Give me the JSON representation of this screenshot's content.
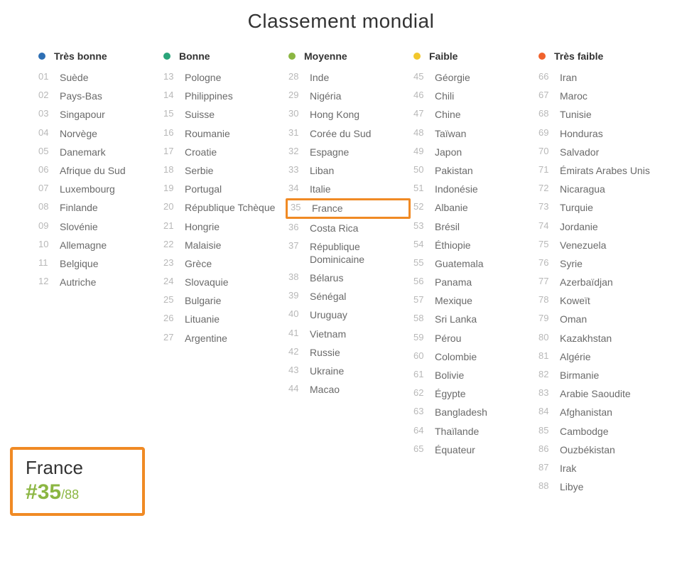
{
  "title": "Classement mondial",
  "categories": [
    {
      "label": "Très bonne",
      "color": "#2e6fb4",
      "items": [
        {
          "rank": "01",
          "name": "Suède"
        },
        {
          "rank": "02",
          "name": "Pays-Bas"
        },
        {
          "rank": "03",
          "name": "Singapour"
        },
        {
          "rank": "04",
          "name": "Norvège"
        },
        {
          "rank": "05",
          "name": "Danemark"
        },
        {
          "rank": "06",
          "name": "Afrique du Sud"
        },
        {
          "rank": "07",
          "name": "Luxembourg"
        },
        {
          "rank": "08",
          "name": "Finlande"
        },
        {
          "rank": "09",
          "name": "Slovénie"
        },
        {
          "rank": "10",
          "name": "Allemagne"
        },
        {
          "rank": "11",
          "name": "Belgique"
        },
        {
          "rank": "12",
          "name": "Autriche"
        }
      ]
    },
    {
      "label": "Bonne",
      "color": "#2aa57a",
      "items": [
        {
          "rank": "13",
          "name": "Pologne"
        },
        {
          "rank": "14",
          "name": "Philippines"
        },
        {
          "rank": "15",
          "name": "Suisse"
        },
        {
          "rank": "16",
          "name": "Roumanie"
        },
        {
          "rank": "17",
          "name": "Croatie"
        },
        {
          "rank": "18",
          "name": "Serbie"
        },
        {
          "rank": "19",
          "name": "Portugal"
        },
        {
          "rank": "20",
          "name": "République Tchèque"
        },
        {
          "rank": "21",
          "name": "Hongrie"
        },
        {
          "rank": "22",
          "name": "Malaisie"
        },
        {
          "rank": "23",
          "name": "Grèce"
        },
        {
          "rank": "24",
          "name": "Slovaquie"
        },
        {
          "rank": "25",
          "name": "Bulgarie"
        },
        {
          "rank": "26",
          "name": "Lituanie"
        },
        {
          "rank": "27",
          "name": "Argentine"
        }
      ]
    },
    {
      "label": "Moyenne",
      "color": "#8bb642",
      "items": [
        {
          "rank": "28",
          "name": "Inde"
        },
        {
          "rank": "29",
          "name": "Nigéria"
        },
        {
          "rank": "30",
          "name": "Hong Kong"
        },
        {
          "rank": "31",
          "name": "Corée du Sud"
        },
        {
          "rank": "32",
          "name": "Espagne"
        },
        {
          "rank": "33",
          "name": "Liban"
        },
        {
          "rank": "34",
          "name": "Italie"
        },
        {
          "rank": "35",
          "name": "France",
          "highlight": true
        },
        {
          "rank": "36",
          "name": "Costa Rica"
        },
        {
          "rank": "37",
          "name": "République Dominicaine"
        },
        {
          "rank": "38",
          "name": "Bélarus"
        },
        {
          "rank": "39",
          "name": "Sénégal"
        },
        {
          "rank": "40",
          "name": "Uruguay"
        },
        {
          "rank": "41",
          "name": "Vietnam"
        },
        {
          "rank": "42",
          "name": "Russie"
        },
        {
          "rank": "43",
          "name": "Ukraine"
        },
        {
          "rank": "44",
          "name": "Macao"
        }
      ]
    },
    {
      "label": "Faible",
      "color": "#f2c72c",
      "items": [
        {
          "rank": "45",
          "name": "Géorgie"
        },
        {
          "rank": "46",
          "name": "Chili"
        },
        {
          "rank": "47",
          "name": "Chine"
        },
        {
          "rank": "48",
          "name": "Taïwan"
        },
        {
          "rank": "49",
          "name": "Japon"
        },
        {
          "rank": "50",
          "name": "Pakistan"
        },
        {
          "rank": "51",
          "name": "Indonésie"
        },
        {
          "rank": "52",
          "name": "Albanie"
        },
        {
          "rank": "53",
          "name": "Brésil"
        },
        {
          "rank": "54",
          "name": "Éthiopie"
        },
        {
          "rank": "55",
          "name": "Guatemala"
        },
        {
          "rank": "56",
          "name": "Panama"
        },
        {
          "rank": "57",
          "name": "Mexique"
        },
        {
          "rank": "58",
          "name": "Sri Lanka"
        },
        {
          "rank": "59",
          "name": "Pérou"
        },
        {
          "rank": "60",
          "name": "Colombie"
        },
        {
          "rank": "61",
          "name": "Bolivie"
        },
        {
          "rank": "62",
          "name": "Égypte"
        },
        {
          "rank": "63",
          "name": "Bangladesh"
        },
        {
          "rank": "64",
          "name": "Thaïlande"
        },
        {
          "rank": "65",
          "name": "Équateur"
        }
      ]
    },
    {
      "label": "Très faible",
      "color": "#f0622c",
      "items": [
        {
          "rank": "66",
          "name": "Iran"
        },
        {
          "rank": "67",
          "name": "Maroc"
        },
        {
          "rank": "68",
          "name": "Tunisie"
        },
        {
          "rank": "69",
          "name": "Honduras"
        },
        {
          "rank": "70",
          "name": "Salvador"
        },
        {
          "rank": "71",
          "name": "Émirats Arabes Unis"
        },
        {
          "rank": "72",
          "name": "Nicaragua"
        },
        {
          "rank": "73",
          "name": "Turquie"
        },
        {
          "rank": "74",
          "name": "Jordanie"
        },
        {
          "rank": "75",
          "name": "Venezuela"
        },
        {
          "rank": "76",
          "name": "Syrie"
        },
        {
          "rank": "77",
          "name": "Azerbaïdjan"
        },
        {
          "rank": "78",
          "name": "Koweït"
        },
        {
          "rank": "79",
          "name": "Oman"
        },
        {
          "rank": "80",
          "name": "Kazakhstan"
        },
        {
          "rank": "81",
          "name": "Algérie"
        },
        {
          "rank": "82",
          "name": "Birmanie"
        },
        {
          "rank": "83",
          "name": "Arabie Saoudite"
        },
        {
          "rank": "84",
          "name": "Afghanistan"
        },
        {
          "rank": "85",
          "name": "Cambodge"
        },
        {
          "rank": "86",
          "name": "Ouzbékistan"
        },
        {
          "rank": "87",
          "name": "Irak"
        },
        {
          "rank": "88",
          "name": "Libye"
        }
      ]
    }
  ],
  "callout": {
    "country": "France",
    "rank_prefix": "#",
    "rank": "35",
    "total_sep": "/",
    "total": "88"
  }
}
